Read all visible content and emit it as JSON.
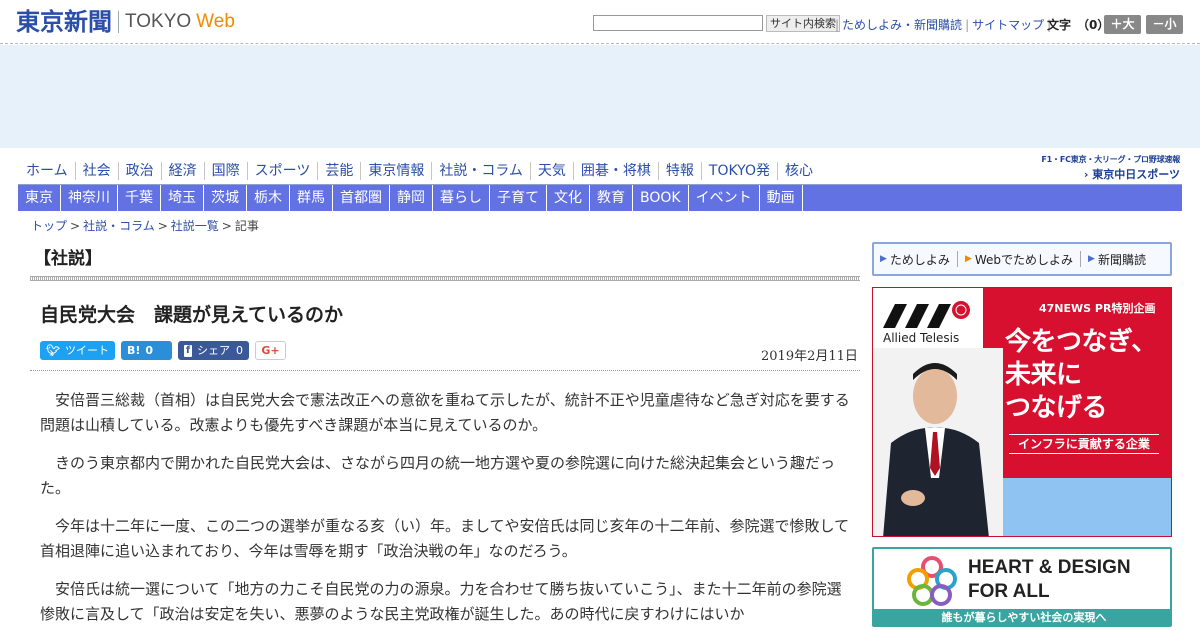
{
  "header": {
    "logo_jp": "東京新聞",
    "logo_tokyo": "TOKYO",
    "logo_web": "Web",
    "search_button": "サイト内検索",
    "links": [
      "ためしよみ・新聞購読",
      "サイトマップ"
    ],
    "font_label": "文字",
    "font_count": "（0）",
    "font_larger": "＋大",
    "font_smaller": "－小"
  },
  "nav_primary": [
    "ホーム",
    "社会",
    "政治",
    "経済",
    "国際",
    "スポーツ",
    "芸能",
    "東京情報",
    "社説・コラム",
    "天気",
    "囲碁・将棋",
    "特報",
    "TOKYO発",
    "核心"
  ],
  "chunichi": {
    "top": "F1・FC東京・大リーグ・プロ野球速報",
    "bottom": "東京中日スポーツ"
  },
  "nav_secondary": [
    "東京",
    "神奈川",
    "千葉",
    "埼玉",
    "茨城",
    "栃木",
    "群馬",
    "首都圏",
    "静岡",
    "暮らし",
    "子育て",
    "文化",
    "教育",
    "BOOK",
    "イベント",
    "動画"
  ],
  "breadcrumb": [
    "トップ",
    "社説・コラム",
    "社説一覧",
    "記事"
  ],
  "article": {
    "section": "【社説】",
    "headline": "自民党大会　課題が見えているのか",
    "date": "2019年2月11日",
    "share": {
      "tweet": "ツイート",
      "hatena_icon": "B!",
      "hatena_count": "0",
      "fb_icon": "f",
      "fb_label": "シェア",
      "fb_count": "0",
      "gplus": "G+"
    },
    "paragraphs": [
      "安倍晋三総裁（首相）は自民党大会で憲法改正への意欲を重ねて示したが、統計不正や児童虐待など急ぎ対応を要する問題は山積している。改憲よりも優先すべき課題が本当に見えているのか。",
      "きのう東京都内で開かれた自民党大会は、さながら四月の統一地方選や夏の参院選に向けた総決起集会という趣だった。",
      "今年は十二年に一度、この二つの選挙が重なる亥（い）年。ましてや安倍氏は同じ亥年の十二年前、参院選で惨敗して首相退陣に追い込まれており、今年は雪辱を期す「政治決戦の年」なのだろう。",
      "安倍氏は統一選について「地方の力こそ自民党の力の源泉。力を合わせて勝ち抜いていこう」、また十二年前の参院選惨敗に言及して「政治は安定を失い、悪夢のような民主党政権が誕生した。あの時代に戻すわけにはいか"
    ]
  },
  "sidebar": {
    "subscribe": [
      "ためしよみ",
      "Webでためしよみ",
      "新聞購読"
    ],
    "ad_allied": {
      "pr": "47NEWS PR特別企画",
      "logo_text": "Allied Telesis",
      "copy": [
        "今をつなぎ、",
        "未来に",
        "つなげる"
      ],
      "tag": "インフラに貢献する企業"
    },
    "ad_heart": {
      "title1": "HEART & DESIGN",
      "title2": "FOR ALL",
      "bar": "誰もが暮らしやすい社会の実現へ"
    }
  },
  "colors": {
    "brand_blue": "#2b4ea8",
    "nav_bar": "#6272e2",
    "accent_orange": "#f08a00",
    "ad_red": "#d7102f",
    "ad_teal": "#3aa5a0"
  }
}
